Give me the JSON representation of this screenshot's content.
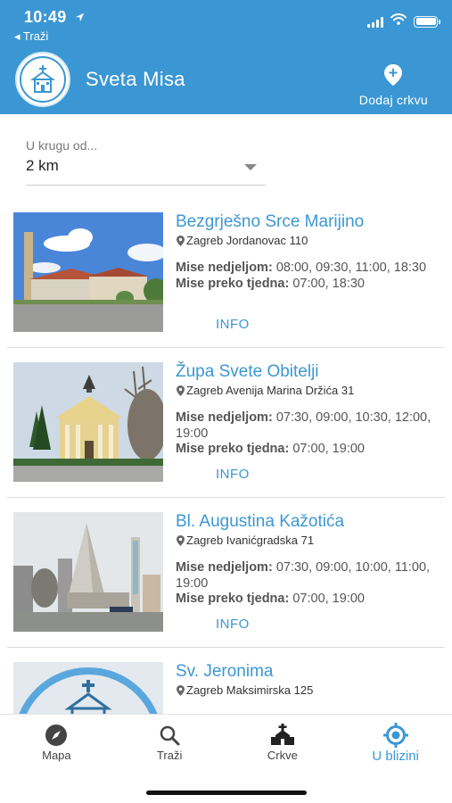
{
  "status_bar": {
    "time": "10:49",
    "back_label": "◂ Traži"
  },
  "header": {
    "title": "Sveta Misa",
    "add_church_label": "Dodaj crkvu"
  },
  "radius": {
    "label": "U krugu od...",
    "value": "2 km"
  },
  "churches": [
    {
      "name": "Bezgrješno Srce Marijino",
      "address": "Zagreb Jordanovac 110",
      "sunday_label": "Mise nedjeljom:",
      "sunday_times": "08:00, 09:30, 11:00, 18:30",
      "weekday_label": "Mise preko tjedna:",
      "weekday_times": "07:00, 18:30",
      "info_label": "INFO"
    },
    {
      "name": "Župa Svete Obitelji",
      "address": "Zagreb Avenija Marina Držića 31",
      "sunday_label": "Mise nedjeljom:",
      "sunday_times": "07:30, 09:00, 10:30, 12:00, 19:00",
      "weekday_label": "Mise preko tjedna:",
      "weekday_times": "07:00, 19:00",
      "info_label": "INFO"
    },
    {
      "name": "Bl. Augustina Kažotića",
      "address": "Zagreb Ivanićgradska 71",
      "sunday_label": "Mise nedjeljom:",
      "sunday_times": "07:30, 09:00, 10:00, 11:00, 19:00",
      "weekday_label": "Mise preko tjedna:",
      "weekday_times": "07:00, 19:00",
      "info_label": "INFO"
    },
    {
      "name": "Sv. Jeronima",
      "address": "Zagreb Maksimirska 125"
    }
  ],
  "tabs": [
    {
      "label": "Mapa",
      "icon": "compass-icon"
    },
    {
      "label": "Traži",
      "icon": "search-icon"
    },
    {
      "label": "Crkve",
      "icon": "church-icon"
    },
    {
      "label": "U blizini",
      "icon": "location-target-icon",
      "active": true
    }
  ],
  "colors": {
    "primary": "#3b97d3",
    "text": "#222222",
    "muted": "#777777"
  }
}
